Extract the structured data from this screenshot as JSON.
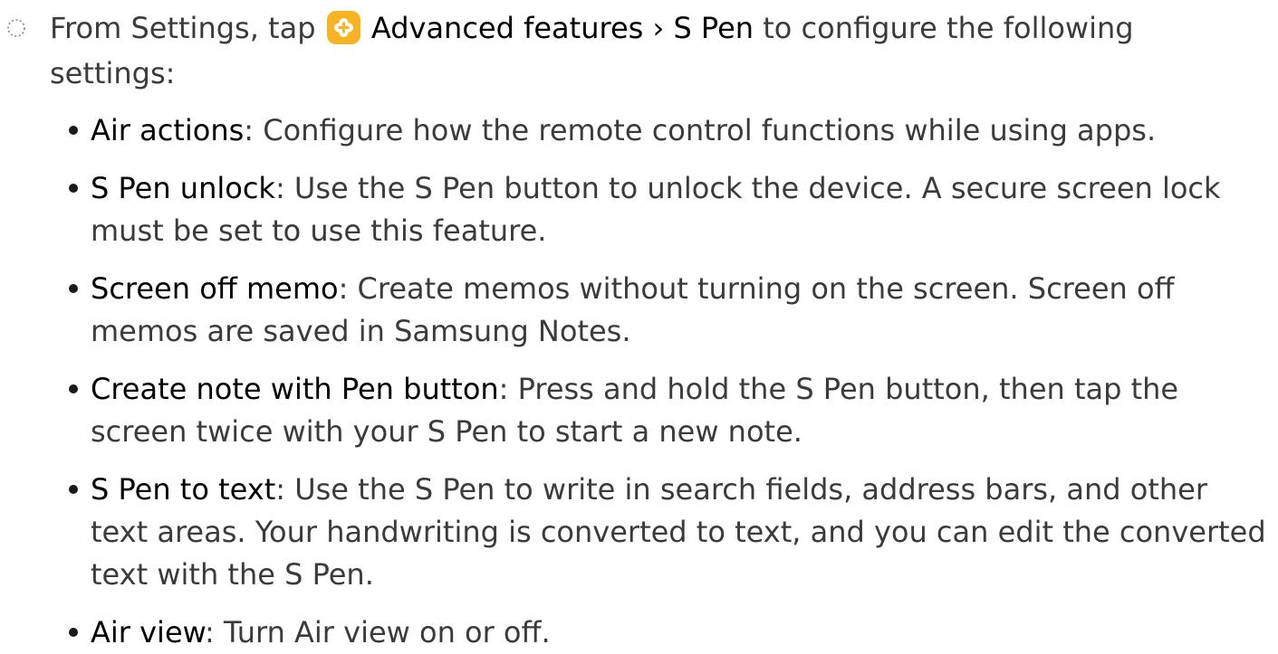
{
  "intro": {
    "prefix": "From Settings, tap",
    "icon": "advanced-features-plus-icon",
    "icon_color": "#f7b321",
    "path_1": "Advanced features",
    "separator": "›",
    "path_2": "S Pen",
    "suffix": "to configure the following settings:"
  },
  "items": [
    {
      "term": "Air actions",
      "desc": ": Configure how the remote control functions while using apps."
    },
    {
      "term": "S Pen unlock",
      "desc": ": Use the S Pen button to unlock the device. A secure screen lock must be set to use this feature."
    },
    {
      "term": "Screen off memo",
      "desc": ": Create memos without turning on the screen. Screen off memos are saved in Samsung Notes."
    },
    {
      "term": "Create note with Pen button",
      "desc": ": Press and hold the S Pen button, then tap the screen twice with your S Pen to start a new note."
    },
    {
      "term": "S Pen to text",
      "desc": ": Use the S Pen to write in search fields, address bars, and other text areas. Your handwriting is converted to text, and you can edit the converted text with the S Pen."
    },
    {
      "term": "Air view",
      "desc": ": Turn Air view on or off."
    }
  ]
}
